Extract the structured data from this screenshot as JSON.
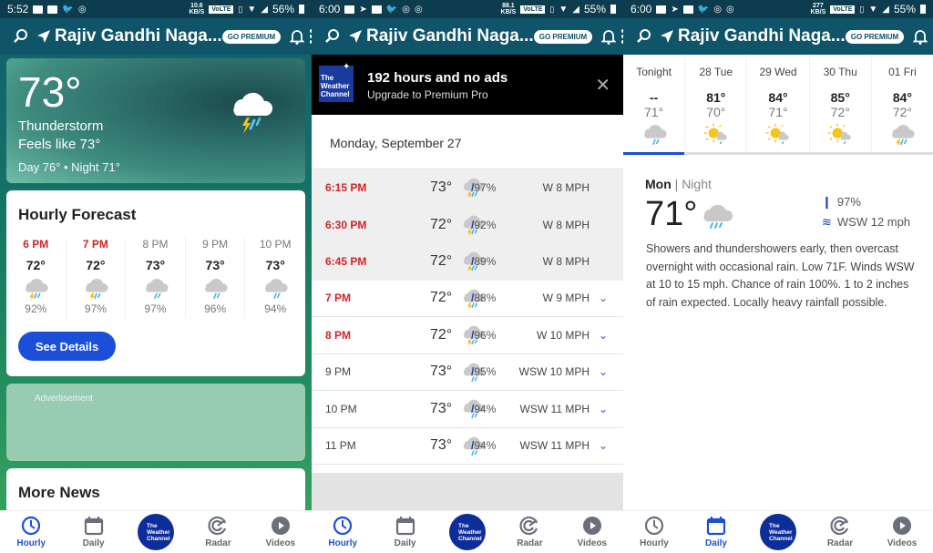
{
  "screens": [
    {
      "status": {
        "time": "5:52",
        "net_speed": "10.6",
        "net_unit": "KB/S",
        "volte": "VoLTE",
        "battery": "56%"
      },
      "appbar": {
        "location": "Rajiv Gandhi Naga...",
        "premium": "GO PREMIUM"
      }
    },
    {
      "status": {
        "time": "6:00",
        "net_speed": "88.1",
        "net_unit": "KB/S",
        "volte": "VoLTE",
        "battery": "55%"
      },
      "appbar": {
        "location": "Rajiv Gandhi Naga...",
        "premium": "GO PREMIUM"
      }
    },
    {
      "status": {
        "time": "6:00",
        "net_speed": "277",
        "net_unit": "KB/S",
        "volte": "VoLTE",
        "battery": "55%"
      },
      "appbar": {
        "location": "Rajiv Gandhi Naga...",
        "premium": "GO PREMIUM"
      }
    }
  ],
  "today": {
    "temp": "73°",
    "condition": "Thunderstorm",
    "feels_like": "Feels like 73°",
    "day_night": "Day 76° • Night 71°",
    "icon": "thunderstorm-icon"
  },
  "hourly_card": {
    "title": "Hourly Forecast",
    "items": [
      {
        "time": "6 PM",
        "temp": "72°",
        "precip": "92%",
        "icon": "thunder-rain",
        "now": true
      },
      {
        "time": "7 PM",
        "temp": "72°",
        "precip": "97%",
        "icon": "thunder-rain",
        "now": true
      },
      {
        "time": "8 PM",
        "temp": "73°",
        "precip": "97%",
        "icon": "rain",
        "now": false
      },
      {
        "time": "9 PM",
        "temp": "73°",
        "precip": "96%",
        "icon": "rain",
        "now": false
      },
      {
        "time": "10 PM",
        "temp": "73°",
        "precip": "94%",
        "icon": "rain",
        "now": false
      }
    ],
    "button": "See Details"
  },
  "ad_label": "Advertisement",
  "more_news": "More News",
  "promo": {
    "logo": [
      "The",
      "Weather",
      "Channel"
    ],
    "headline": "192 hours and no ads",
    "sub": "Upgrade to Premium Pro"
  },
  "hourly_list": {
    "date": "Monday, September 27",
    "rows": [
      {
        "time": "6:15 PM",
        "temp": "73°",
        "precip": "97%",
        "wind": "W 8 MPH",
        "past": true,
        "red": true,
        "icon": "thunder-rain",
        "expand": false
      },
      {
        "time": "6:30 PM",
        "temp": "72°",
        "precip": "92%",
        "wind": "W 8 MPH",
        "past": true,
        "red": true,
        "icon": "thunder-rain",
        "expand": false
      },
      {
        "time": "6:45 PM",
        "temp": "72°",
        "precip": "89%",
        "wind": "W 8 MPH",
        "past": true,
        "red": true,
        "icon": "thunder-rain",
        "expand": false
      },
      {
        "time": "7 PM",
        "temp": "72°",
        "precip": "88%",
        "wind": "W 9 MPH",
        "past": false,
        "red": true,
        "icon": "thunder-rain",
        "expand": true
      },
      {
        "time": "8 PM",
        "temp": "72°",
        "precip": "96%",
        "wind": "W 10 MPH",
        "past": false,
        "red": true,
        "icon": "thunder-rain",
        "expand": true
      },
      {
        "time": "9 PM",
        "temp": "73°",
        "precip": "95%",
        "wind": "WSW 10 MPH",
        "past": false,
        "red": false,
        "icon": "rain",
        "expand": true
      },
      {
        "time": "10 PM",
        "temp": "73°",
        "precip": "94%",
        "wind": "WSW 11 MPH",
        "past": false,
        "red": false,
        "icon": "rain",
        "expand": true
      },
      {
        "time": "11 PM",
        "temp": "73°",
        "precip": "94%",
        "wind": "WSW 11 MPH",
        "past": false,
        "red": false,
        "icon": "rain",
        "expand": true
      }
    ]
  },
  "daily": {
    "days": [
      {
        "label": "Tonight",
        "hi": "--",
        "lo": "71°",
        "icon": "rain",
        "selected": true
      },
      {
        "label": "28 Tue",
        "hi": "81°",
        "lo": "70°",
        "icon": "sun-rain",
        "selected": false
      },
      {
        "label": "29 Wed",
        "hi": "84°",
        "lo": "71°",
        "icon": "sun-rain",
        "selected": false
      },
      {
        "label": "30 Thu",
        "hi": "85°",
        "lo": "72°",
        "icon": "sun-rain",
        "selected": false
      },
      {
        "label": "01 Fri",
        "hi": "84°",
        "lo": "72°",
        "icon": "thunder-rain",
        "selected": false
      }
    ],
    "detail": {
      "day": "Mon",
      "sep": " | ",
      "period": "Night",
      "temp": "71°",
      "precip": "97%",
      "wind": "WSW 12 mph",
      "narrative": "Showers and thundershowers early, then overcast overnight with occasional rain. Low 71F. Winds WSW at 10 to 15 mph. Chance of rain 100%. 1 to 2 inches of rain expected.  Locally heavy rainfall possible."
    }
  },
  "nav": {
    "items": [
      "Hourly",
      "Daily",
      "Radar",
      "Videos"
    ],
    "logo": [
      "The",
      "Weather",
      "Channel"
    ],
    "active": [
      "Hourly",
      "Hourly",
      "Daily"
    ]
  },
  "colors": {
    "accent": "#1c4fd8",
    "alert_red": "#d0242a",
    "appbar": "#0f5468",
    "statusbar": "#0c3c4d",
    "logo_blue": "#0d2d9a"
  }
}
